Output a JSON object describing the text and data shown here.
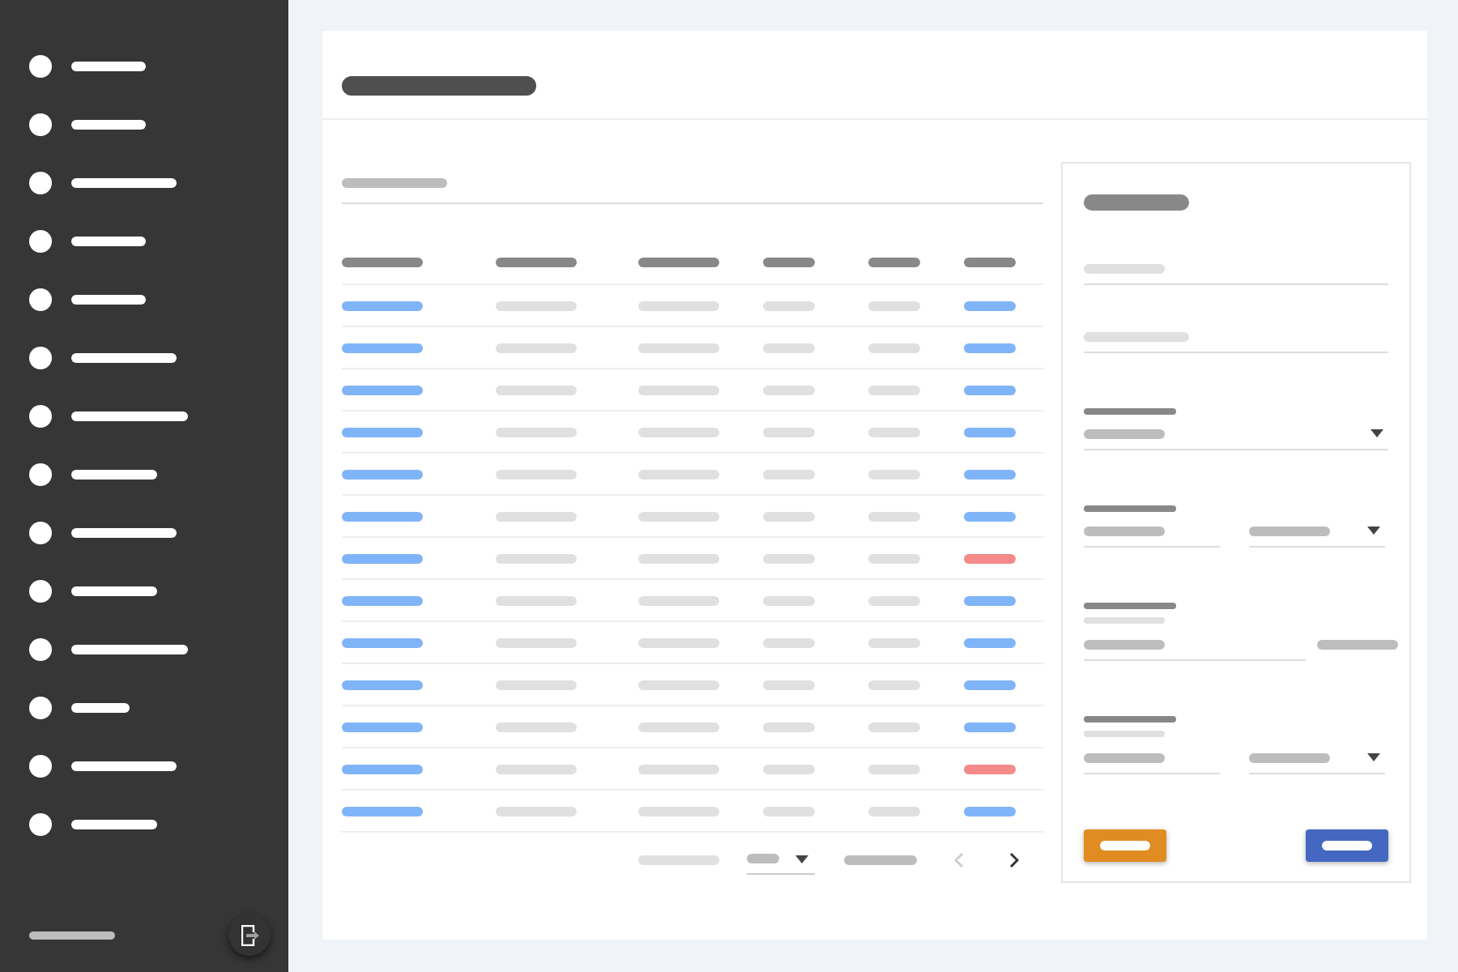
{
  "sidebar": {
    "items": [
      {
        "selected": false
      },
      {
        "selected": false
      },
      {
        "selected": false
      },
      {
        "selected": false
      },
      {
        "selected": false
      },
      {
        "selected": false
      },
      {
        "selected": false
      },
      {
        "selected": false
      },
      {
        "selected": false
      },
      {
        "selected": false
      },
      {
        "selected": false
      },
      {
        "selected": false
      },
      {
        "selected": false
      },
      {
        "selected": false
      }
    ]
  },
  "filter": {
    "filled": true
  },
  "table": {
    "columns": [
      {
        "kind": "link"
      },
      {
        "kind": "text"
      },
      {
        "kind": "text"
      },
      {
        "kind": "text"
      },
      {
        "kind": "text"
      },
      {
        "kind": "status"
      }
    ],
    "rows": [
      {
        "color": "#80b4f8"
      },
      {
        "color": "#80b4f8"
      },
      {
        "color": "#80b4f8"
      },
      {
        "color": "#80b4f8"
      },
      {
        "color": "#80b4f8"
      },
      {
        "color": "#80b4f8"
      },
      {
        "color": "#f48a8a"
      },
      {
        "color": "#80b4f8"
      },
      {
        "color": "#80b4f8"
      },
      {
        "color": "#80b4f8"
      },
      {
        "color": "#80b4f8"
      },
      {
        "color": "#f48a8a"
      },
      {
        "color": "#80b4f8"
      }
    ]
  },
  "pagination": {
    "previous": {
      "disabled": true
    },
    "next": {
      "disabled": false
    }
  },
  "form": {
    "groups": [
      {
        "labeled": false,
        "hint": false,
        "controls": [
          {
            "kind": "input",
            "filled": false
          }
        ]
      },
      {
        "labeled": false,
        "hint": false,
        "controls": [
          {
            "kind": "input",
            "filled": false
          }
        ]
      },
      {
        "labeled": true,
        "hint": false,
        "controls": [
          {
            "kind": "select",
            "filled": true
          }
        ]
      },
      {
        "labeled": true,
        "hint": false,
        "controls": [
          {
            "kind": "input",
            "filled": true
          },
          {
            "kind": "select",
            "filled": true
          }
        ]
      },
      {
        "labeled": true,
        "hint": true,
        "controls": [
          {
            "kind": "input",
            "filled": true
          },
          {
            "kind": "suffix"
          }
        ]
      },
      {
        "labeled": true,
        "hint": true,
        "controls": [
          {
            "kind": "input",
            "filled": true
          },
          {
            "kind": "select",
            "filled": true
          }
        ]
      }
    ],
    "buttons": [
      {
        "color": "#e08c22"
      },
      {
        "color": "#4468c2"
      }
    ]
  }
}
